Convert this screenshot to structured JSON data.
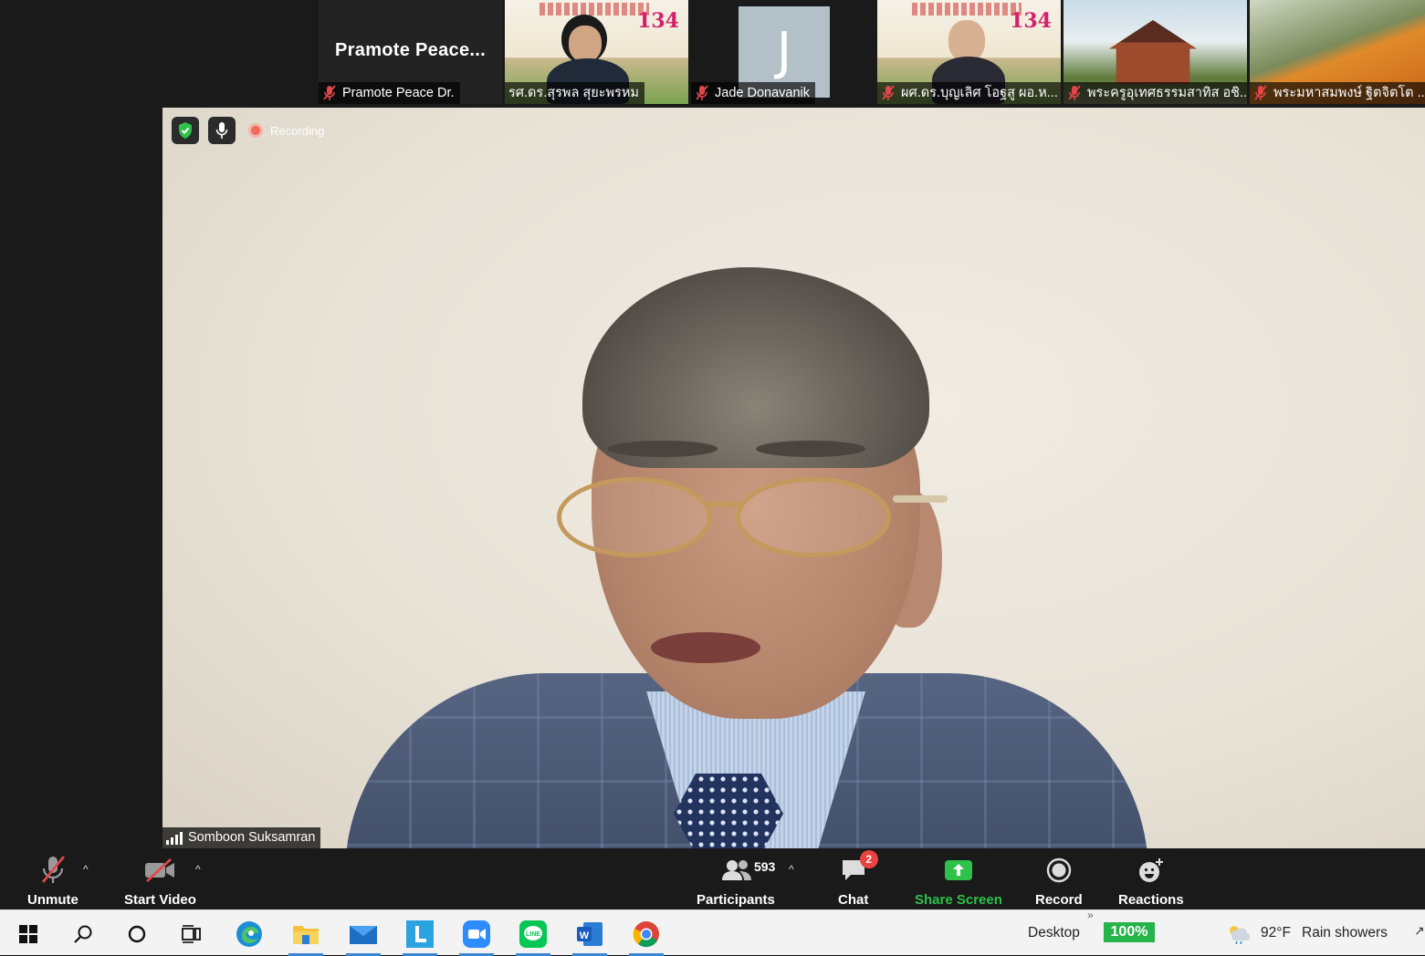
{
  "gallery": {
    "tiles": [
      {
        "big_name": "Pramote  Peace...",
        "name": "Pramote Peace  Dr.",
        "muted": true
      },
      {
        "name": "รศ.ดร.สุรพล สุยะพรหม",
        "muted": false
      },
      {
        "avatar_letter": "J",
        "name": "Jade Donavanik",
        "muted": true
      },
      {
        "name": "ผศ.ดร.บุญเลิศ โอฐสู ผอ.ห...",
        "muted": true
      },
      {
        "name": "พระครูอุเทศธรรมสาทิส อชิ...",
        "muted": true
      },
      {
        "name": "พระมหาสมพงษ์ ฐิตจิตโต ...",
        "muted": true
      }
    ],
    "banner_number": "134"
  },
  "main_video": {
    "recording_label": "Recording",
    "speaker_name": "Somboon Suksamran"
  },
  "controls": {
    "unmute": "Unmute",
    "start_video": "Start Video",
    "participants": "Participants",
    "participant_count": "593",
    "chat": "Chat",
    "chat_badge": "2",
    "share_screen": "Share Screen",
    "record": "Record",
    "reactions": "Reactions"
  },
  "taskbar": {
    "desktop": "Desktop",
    "battery": "100%",
    "weather_temp": "92°F",
    "weather_text": "Rain showers",
    "apps": [
      "windows-start-icon",
      "search-icon",
      "cortana-icon",
      "task-view-icon",
      "edge-icon",
      "file-explorer-icon",
      "mail-icon",
      "l-app-icon",
      "zoom-icon",
      "line-icon",
      "word-icon",
      "chrome-icon"
    ]
  },
  "colors": {
    "share_green": "#2ec24a",
    "recording_dot": "#f06a5a",
    "chat_badge": "#e8433e",
    "battery_green": "#26b34a"
  }
}
